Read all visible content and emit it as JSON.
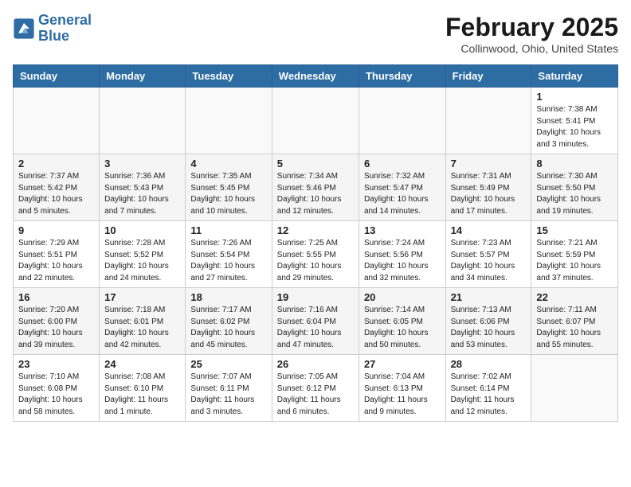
{
  "header": {
    "logo_line1": "General",
    "logo_line2": "Blue",
    "month": "February 2025",
    "location": "Collinwood, Ohio, United States"
  },
  "weekdays": [
    "Sunday",
    "Monday",
    "Tuesday",
    "Wednesday",
    "Thursday",
    "Friday",
    "Saturday"
  ],
  "weeks": [
    [
      {
        "day": "",
        "info": ""
      },
      {
        "day": "",
        "info": ""
      },
      {
        "day": "",
        "info": ""
      },
      {
        "day": "",
        "info": ""
      },
      {
        "day": "",
        "info": ""
      },
      {
        "day": "",
        "info": ""
      },
      {
        "day": "1",
        "info": "Sunrise: 7:38 AM\nSunset: 5:41 PM\nDaylight: 10 hours and 3 minutes."
      }
    ],
    [
      {
        "day": "2",
        "info": "Sunrise: 7:37 AM\nSunset: 5:42 PM\nDaylight: 10 hours and 5 minutes."
      },
      {
        "day": "3",
        "info": "Sunrise: 7:36 AM\nSunset: 5:43 PM\nDaylight: 10 hours and 7 minutes."
      },
      {
        "day": "4",
        "info": "Sunrise: 7:35 AM\nSunset: 5:45 PM\nDaylight: 10 hours and 10 minutes."
      },
      {
        "day": "5",
        "info": "Sunrise: 7:34 AM\nSunset: 5:46 PM\nDaylight: 10 hours and 12 minutes."
      },
      {
        "day": "6",
        "info": "Sunrise: 7:32 AM\nSunset: 5:47 PM\nDaylight: 10 hours and 14 minutes."
      },
      {
        "day": "7",
        "info": "Sunrise: 7:31 AM\nSunset: 5:49 PM\nDaylight: 10 hours and 17 minutes."
      },
      {
        "day": "8",
        "info": "Sunrise: 7:30 AM\nSunset: 5:50 PM\nDaylight: 10 hours and 19 minutes."
      }
    ],
    [
      {
        "day": "9",
        "info": "Sunrise: 7:29 AM\nSunset: 5:51 PM\nDaylight: 10 hours and 22 minutes."
      },
      {
        "day": "10",
        "info": "Sunrise: 7:28 AM\nSunset: 5:52 PM\nDaylight: 10 hours and 24 minutes."
      },
      {
        "day": "11",
        "info": "Sunrise: 7:26 AM\nSunset: 5:54 PM\nDaylight: 10 hours and 27 minutes."
      },
      {
        "day": "12",
        "info": "Sunrise: 7:25 AM\nSunset: 5:55 PM\nDaylight: 10 hours and 29 minutes."
      },
      {
        "day": "13",
        "info": "Sunrise: 7:24 AM\nSunset: 5:56 PM\nDaylight: 10 hours and 32 minutes."
      },
      {
        "day": "14",
        "info": "Sunrise: 7:23 AM\nSunset: 5:57 PM\nDaylight: 10 hours and 34 minutes."
      },
      {
        "day": "15",
        "info": "Sunrise: 7:21 AM\nSunset: 5:59 PM\nDaylight: 10 hours and 37 minutes."
      }
    ],
    [
      {
        "day": "16",
        "info": "Sunrise: 7:20 AM\nSunset: 6:00 PM\nDaylight: 10 hours and 39 minutes."
      },
      {
        "day": "17",
        "info": "Sunrise: 7:18 AM\nSunset: 6:01 PM\nDaylight: 10 hours and 42 minutes."
      },
      {
        "day": "18",
        "info": "Sunrise: 7:17 AM\nSunset: 6:02 PM\nDaylight: 10 hours and 45 minutes."
      },
      {
        "day": "19",
        "info": "Sunrise: 7:16 AM\nSunset: 6:04 PM\nDaylight: 10 hours and 47 minutes."
      },
      {
        "day": "20",
        "info": "Sunrise: 7:14 AM\nSunset: 6:05 PM\nDaylight: 10 hours and 50 minutes."
      },
      {
        "day": "21",
        "info": "Sunrise: 7:13 AM\nSunset: 6:06 PM\nDaylight: 10 hours and 53 minutes."
      },
      {
        "day": "22",
        "info": "Sunrise: 7:11 AM\nSunset: 6:07 PM\nDaylight: 10 hours and 55 minutes."
      }
    ],
    [
      {
        "day": "23",
        "info": "Sunrise: 7:10 AM\nSunset: 6:08 PM\nDaylight: 10 hours and 58 minutes."
      },
      {
        "day": "24",
        "info": "Sunrise: 7:08 AM\nSunset: 6:10 PM\nDaylight: 11 hours and 1 minute."
      },
      {
        "day": "25",
        "info": "Sunrise: 7:07 AM\nSunset: 6:11 PM\nDaylight: 11 hours and 3 minutes."
      },
      {
        "day": "26",
        "info": "Sunrise: 7:05 AM\nSunset: 6:12 PM\nDaylight: 11 hours and 6 minutes."
      },
      {
        "day": "27",
        "info": "Sunrise: 7:04 AM\nSunset: 6:13 PM\nDaylight: 11 hours and 9 minutes."
      },
      {
        "day": "28",
        "info": "Sunrise: 7:02 AM\nSunset: 6:14 PM\nDaylight: 11 hours and 12 minutes."
      },
      {
        "day": "",
        "info": ""
      }
    ]
  ]
}
